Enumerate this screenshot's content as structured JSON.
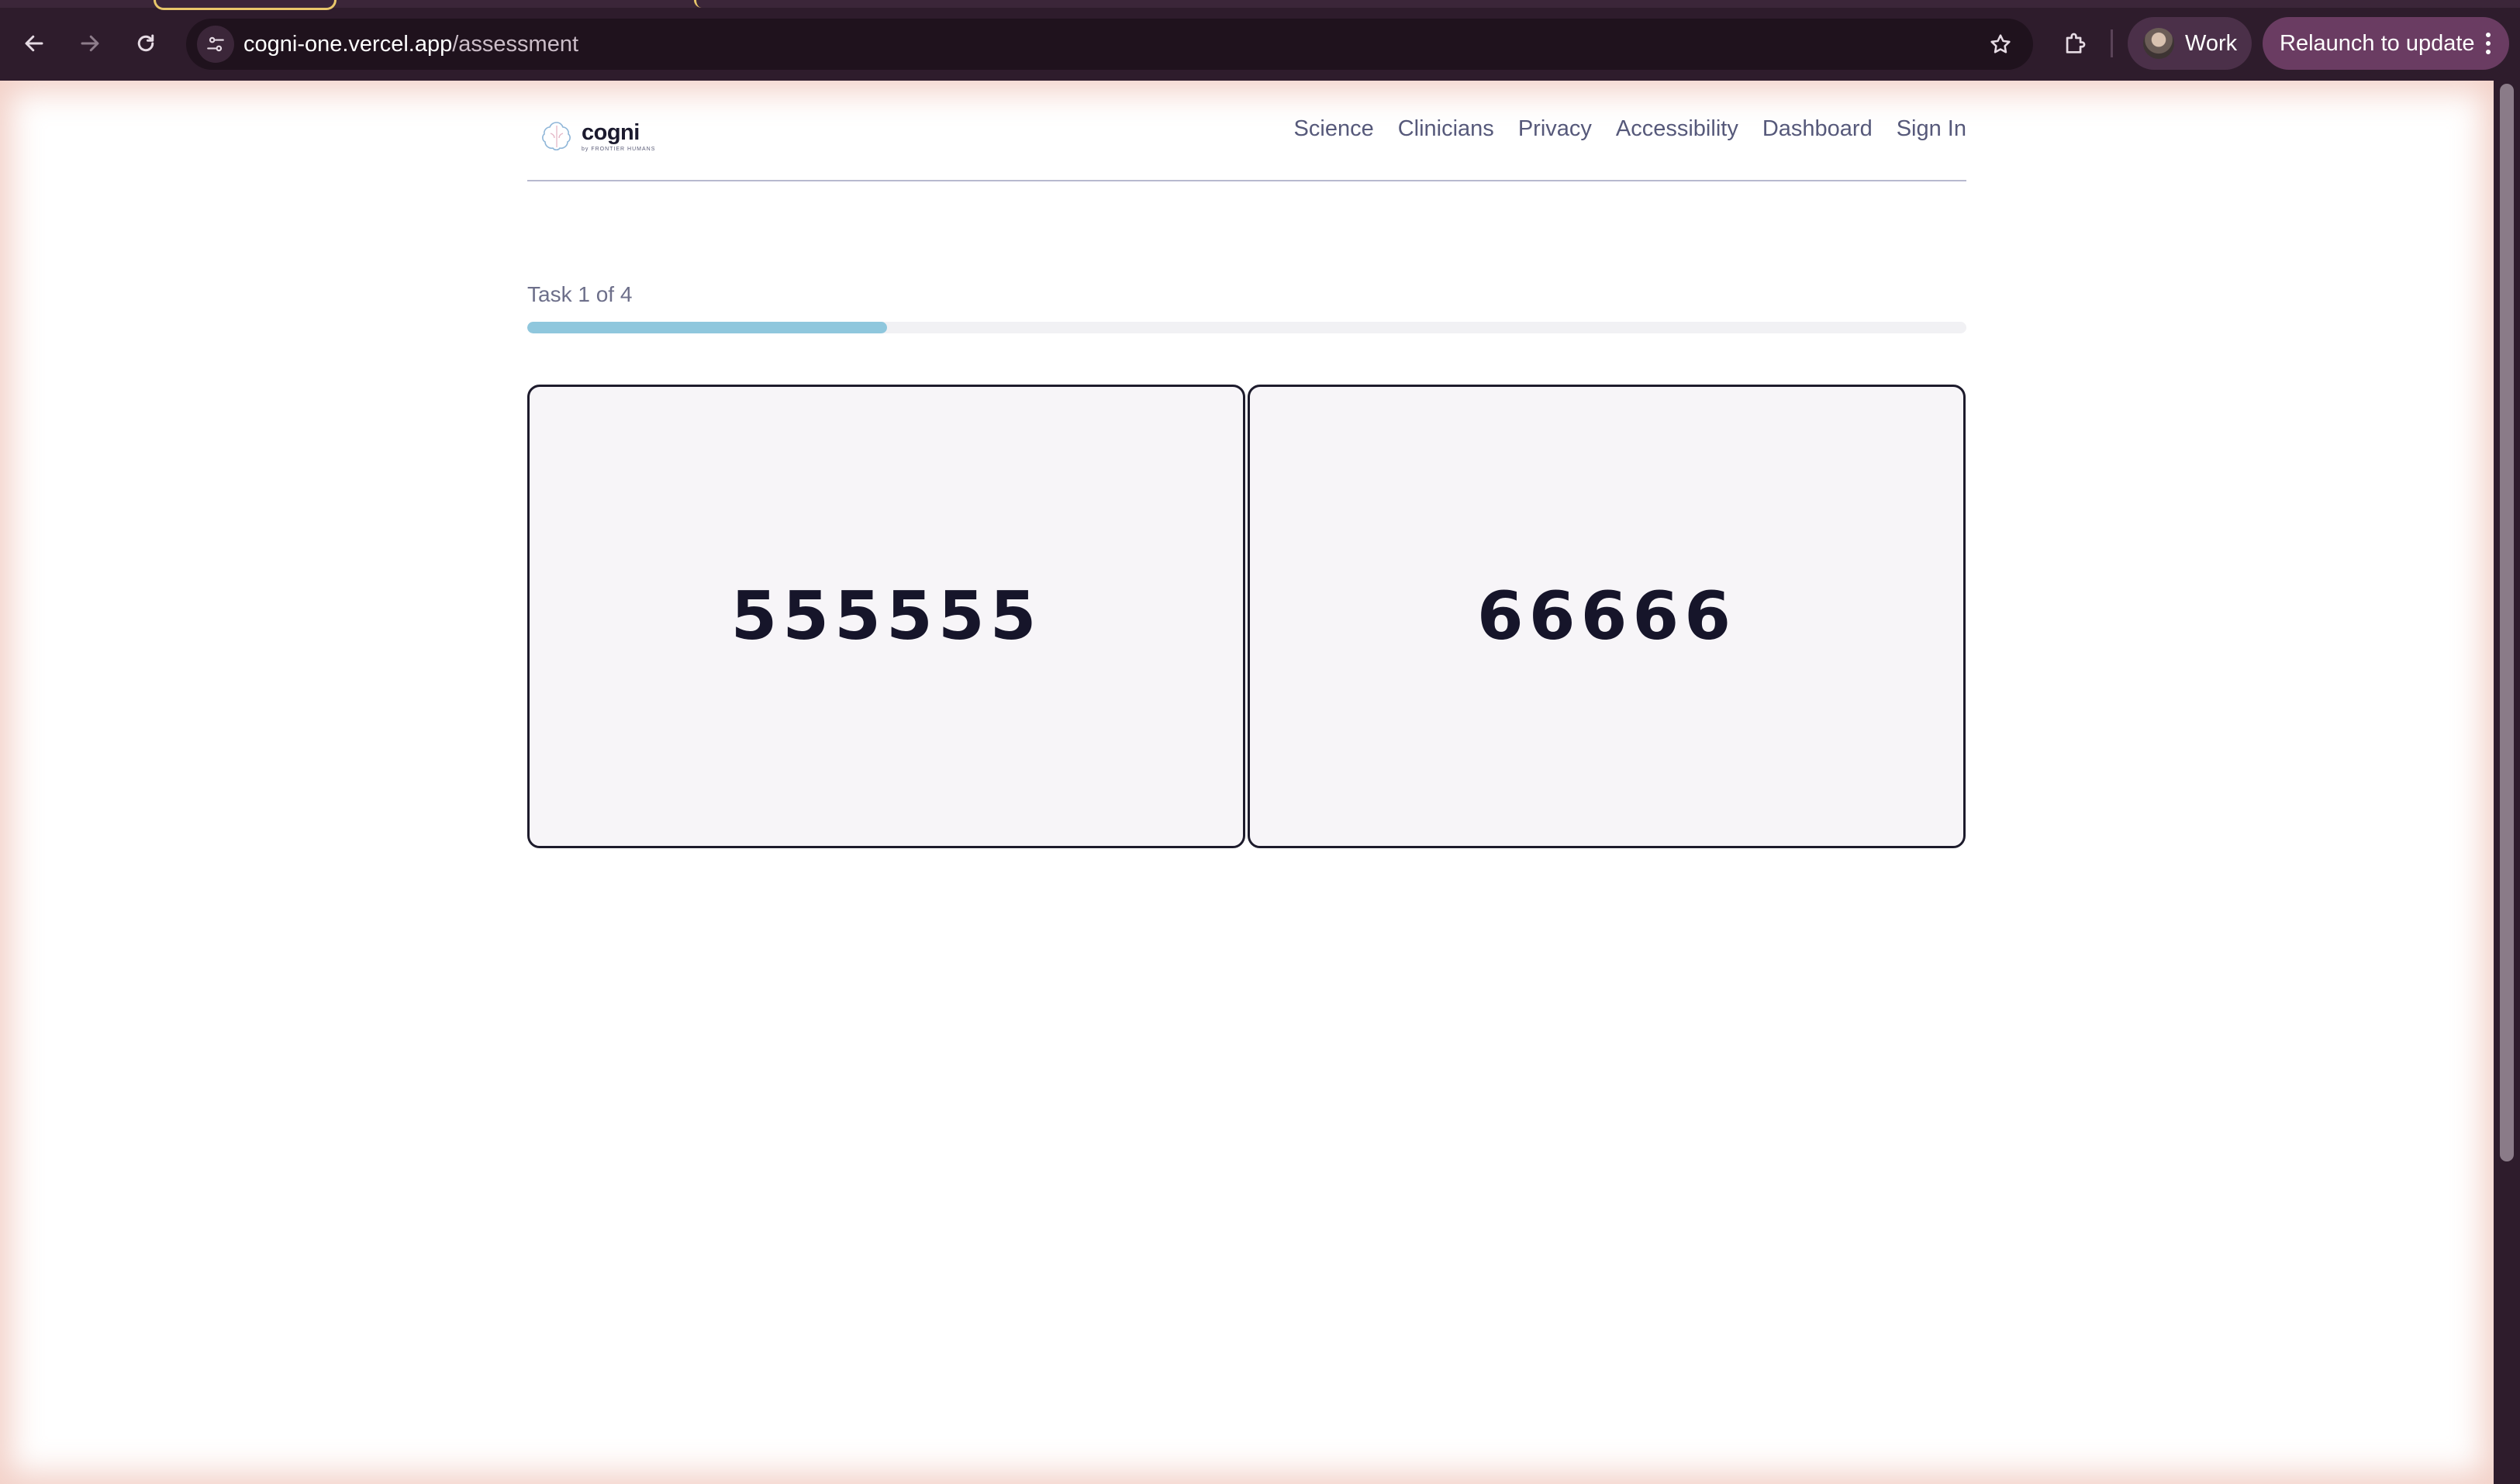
{
  "browser": {
    "url_domain": "cogni-one.vercel.app",
    "url_path": "/assessment",
    "profile_label": "Work",
    "relaunch_label": "Relaunch to update",
    "icons": [
      "back-icon",
      "forward-icon",
      "reload-icon",
      "site-info-icon",
      "star-icon",
      "extensions-icon",
      "menu-icon"
    ]
  },
  "site": {
    "logo_word": "cogni",
    "logo_sub": "by FRONTIER HUMANS",
    "nav": [
      "Science",
      "Clinicians",
      "Privacy",
      "Accessibility",
      "Dashboard",
      "Sign In"
    ]
  },
  "assessment": {
    "task_label": "Task 1 of 4",
    "progress_fraction": 0.25,
    "progress_color": "#8fc7dd",
    "cards": [
      {
        "value": "555555"
      },
      {
        "value": "66666"
      }
    ]
  }
}
